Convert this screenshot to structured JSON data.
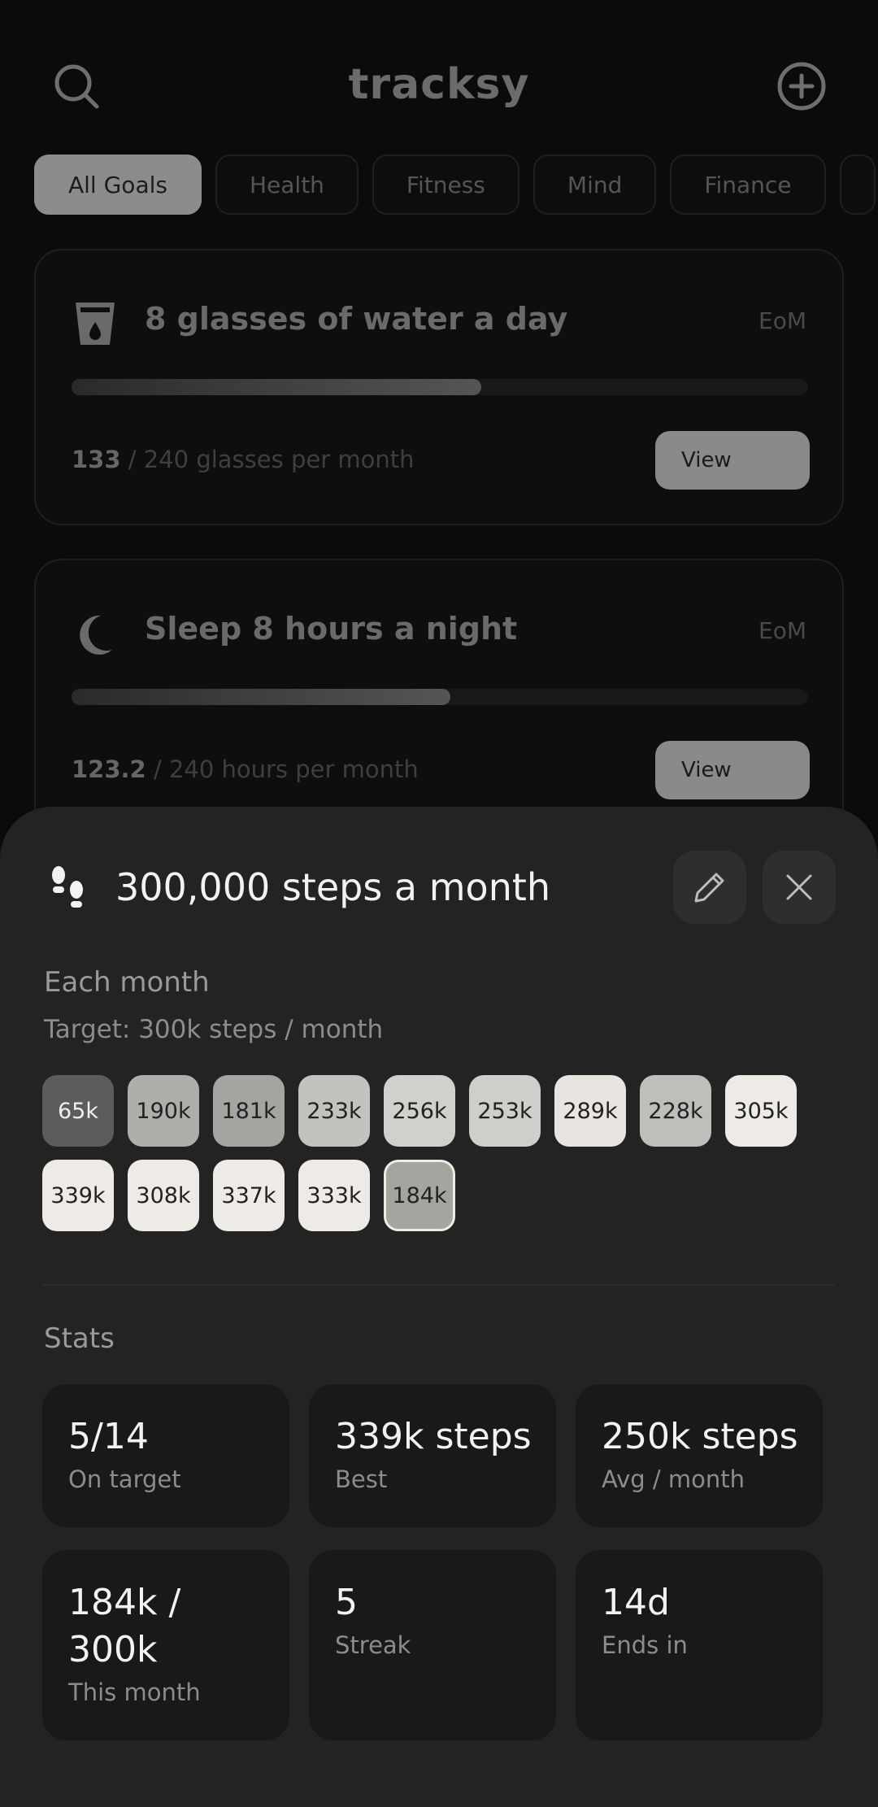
{
  "app": {
    "title": "tracksy"
  },
  "filters": [
    {
      "label": "All Goals",
      "active": true
    },
    {
      "label": "Health",
      "active": false
    },
    {
      "label": "Fitness",
      "active": false
    },
    {
      "label": "Mind",
      "active": false
    },
    {
      "label": "Finance",
      "active": false
    }
  ],
  "goals": [
    {
      "title": "8 glasses of water a day",
      "badge": "EoM",
      "current": "133",
      "rest": " / 240 glasses per month",
      "progress": 0.556,
      "view_label": "View",
      "icon": "glass-icon"
    },
    {
      "title": "Sleep 8 hours a night",
      "badge": "EoM",
      "current": "123.2",
      "rest": " / 240 hours per month",
      "progress": 0.514,
      "view_label": "View",
      "icon": "moon-icon"
    }
  ],
  "sheet": {
    "title": "300,000 steps a month",
    "icon": "footsteps-icon",
    "section_title": "Each month",
    "target": "Target: 300k steps / month",
    "months": [
      {
        "label": "65k",
        "color": "#5c5c5c",
        "text_color": "#eeeeee"
      },
      {
        "label": "190k",
        "color": "#b0aeab",
        "text_color": "#222222"
      },
      {
        "label": "181k",
        "color": "#a6a4a1",
        "text_color": "#222222"
      },
      {
        "label": "233k",
        "color": "#c4c2bf",
        "text_color": "#222222"
      },
      {
        "label": "256k",
        "color": "#d2d0cc",
        "text_color": "#222222"
      },
      {
        "label": "253k",
        "color": "#d0cecb",
        "text_color": "#222222"
      },
      {
        "label": "289k",
        "color": "#e8e5e0",
        "text_color": "#222222"
      },
      {
        "label": "228k",
        "color": "#c0bebb",
        "text_color": "#222222"
      },
      {
        "label": "305k",
        "color": "#eeebe6",
        "text_color": "#222222"
      },
      {
        "label": "339k",
        "color": "#eeebe6",
        "text_color": "#222222"
      },
      {
        "label": "308k",
        "color": "#eeebe6",
        "text_color": "#222222"
      },
      {
        "label": "337k",
        "color": "#eeebe6",
        "text_color": "#222222"
      },
      {
        "label": "333k",
        "color": "#eeebe6",
        "text_color": "#222222"
      },
      {
        "label": "184k",
        "color": "#a6a49f",
        "text_color": "#222222",
        "current": true
      }
    ],
    "stats_title": "Stats",
    "stats": [
      {
        "value": "5/14",
        "label": "On target"
      },
      {
        "value": "339k steps",
        "label": "Best"
      },
      {
        "value": "250k steps",
        "label": "Avg / month"
      },
      {
        "value": "184k /\n300k",
        "label": "This month"
      },
      {
        "value": "5",
        "label": "Streak"
      },
      {
        "value": "14d",
        "label": "Ends in"
      }
    ]
  },
  "colors": {
    "background": "#0b0b0b",
    "sheet": "#232323",
    "stat_card": "#191919",
    "chip_active": "#8c8c8c"
  }
}
